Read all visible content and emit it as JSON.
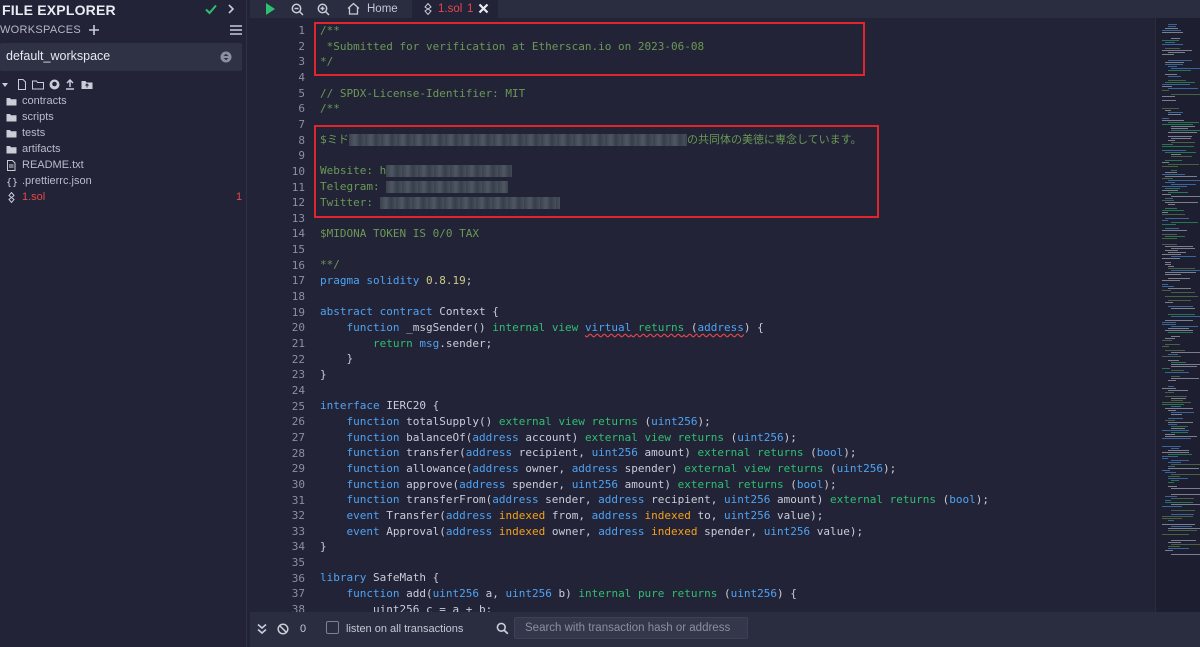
{
  "sidebar": {
    "title": "FILE EXPLORER",
    "workspaces_label": "WORKSPACES",
    "workspace_selected": "default_workspace",
    "files": [
      {
        "label": "contracts",
        "icon": "folder-icon",
        "active": false,
        "badge": ""
      },
      {
        "label": "scripts",
        "icon": "folder-icon",
        "active": false,
        "badge": ""
      },
      {
        "label": "tests",
        "icon": "folder-icon",
        "active": false,
        "badge": ""
      },
      {
        "label": "artifacts",
        "icon": "folder-icon",
        "active": false,
        "badge": ""
      },
      {
        "label": "README.txt",
        "icon": "file-icon",
        "active": false,
        "badge": ""
      },
      {
        "label": ".prettierrc.json",
        "icon": "json-icon",
        "active": false,
        "badge": ""
      },
      {
        "label": "1.sol",
        "icon": "solidity-icon",
        "active": true,
        "badge": "1"
      }
    ]
  },
  "tabs": {
    "home": "Home",
    "file": "1.sol",
    "file_badge": "1"
  },
  "colors": {
    "accent_green": "#2fbf71",
    "error_red": "#e4484d",
    "highlight_box": "#e0262b",
    "keyword_blue": "#4ea3f3",
    "indexed_orange": "#f4a11c"
  },
  "editor": {
    "line_numbers": [
      "1",
      "2",
      "3",
      "4",
      "5",
      "6",
      "7",
      "8",
      "9",
      "10",
      "11",
      "12",
      "13",
      "14",
      "15",
      "16",
      "17",
      "18",
      "19",
      "20",
      "21",
      "22",
      "23",
      "24",
      "25",
      "26",
      "27",
      "28",
      "29",
      "30",
      "31",
      "32",
      "33",
      "34",
      "35",
      "36",
      "37",
      "38"
    ],
    "lines": {
      "l1": "/**",
      "l2": " *Submitted for verification at Etherscan.io on 2023-06-08",
      "l3": "*/",
      "l5": "// SPDX-License-Identifier: MIT",
      "l6": "/**",
      "l8a": "$ミド",
      "l8b": "の共同体の美徳に専念しています。",
      "l10": "Website: h",
      "l11": "Telegram: ",
      "l12": "Twitter: ",
      "l14": "$MIDONA TOKEN IS 0/0 TAX",
      "l16": "**/",
      "l17_kw": "pragma solidity",
      "l17_ver": "0.8.19",
      "l17_end": ";",
      "l19_kw": "abstract contract",
      "l19_rest": " Context {",
      "l20_name": " _msgSender() ",
      "l21_obj": "msg",
      "l21_rest": ".sender;",
      "l22": "    }",
      "l23": "}",
      "l25_kw": "interface",
      "l25_rest": " IERC20 {",
      "l35": "}",
      "l36_kw": "library",
      "l36_rest": " SafeMath {",
      "l37_name": " add(",
      "l38": "        uint256 c = a + b;"
    }
  },
  "terminal": {
    "count": "0",
    "listen_label": "listen on all transactions",
    "search_placeholder": "Search with transaction hash or address"
  }
}
